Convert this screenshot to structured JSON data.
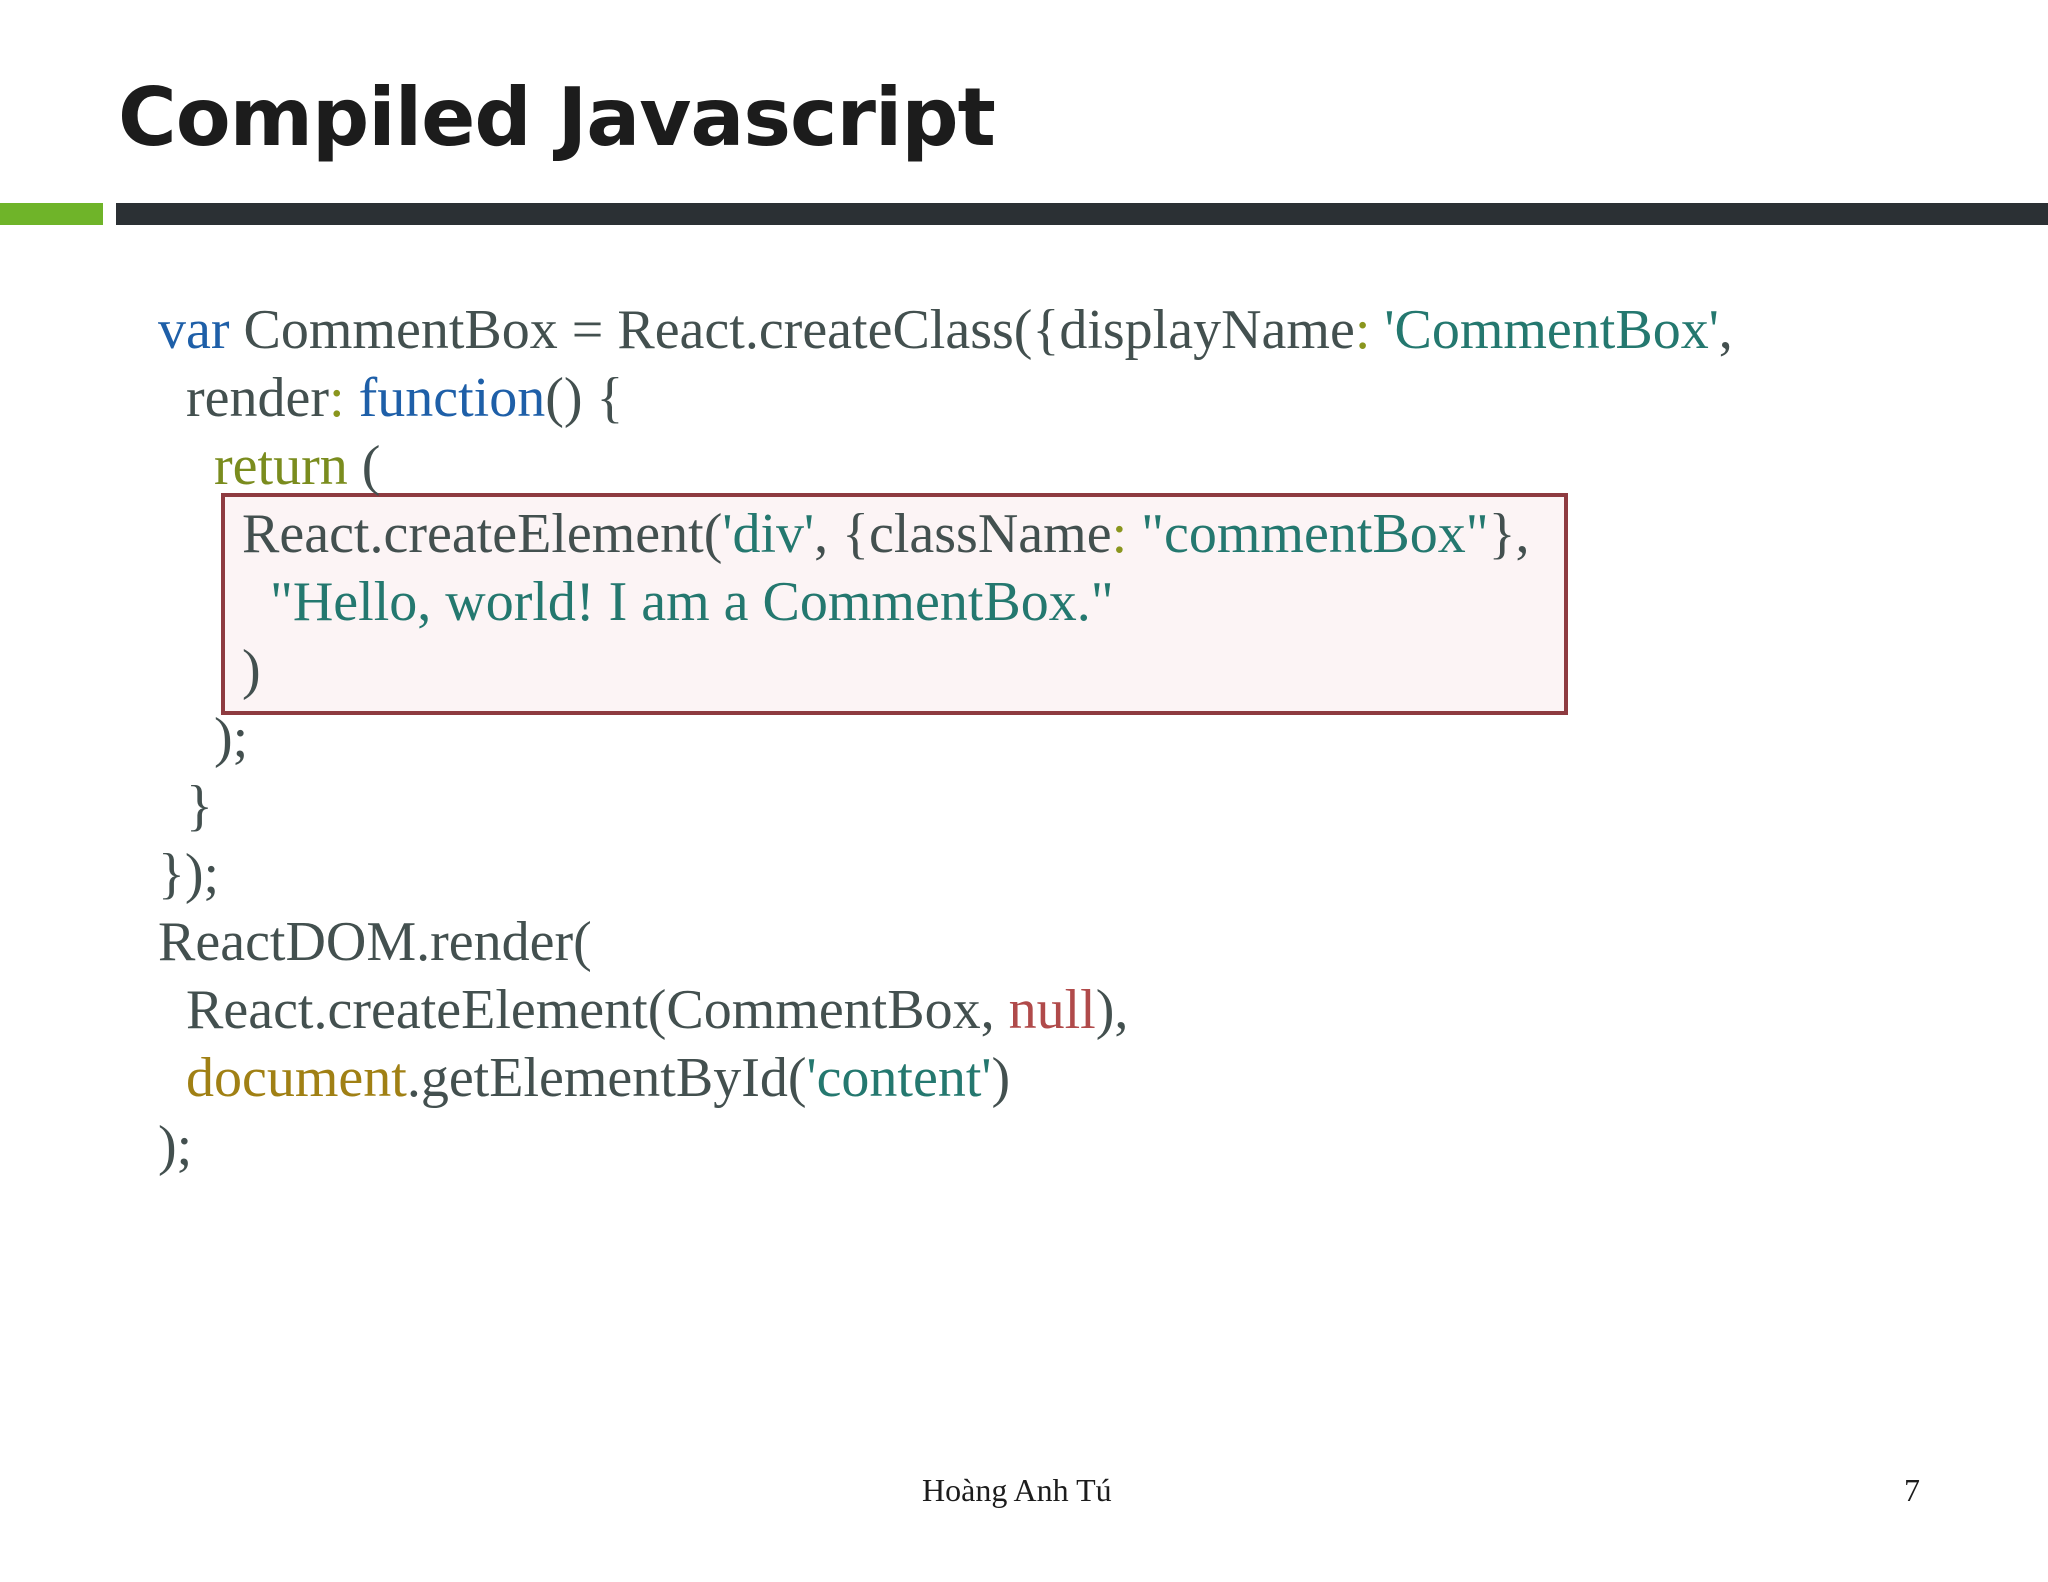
{
  "slide": {
    "title": "Compiled Javascript",
    "footer_author": "Hoàng Anh Tú",
    "page_number": "7"
  },
  "code": {
    "l1_var": "var",
    "l1_a": " CommentBox ",
    "l1_eq": "=",
    "l1_b": " React.createClass({displayName",
    "l1_colon": ":",
    "l1_str": " 'CommentBox'",
    "l1_c": ",",
    "l2_a": "  render",
    "l2_colon": ":",
    "l2_fn": " function",
    "l2_b": "() {",
    "l3_ret": "    return",
    "l3_a": " (",
    "l4_a": "      React.createElement(",
    "l4_str1": "'div'",
    "l4_b": ", {className",
    "l4_colon": ":",
    "l4_str2": " \"commentBox\"",
    "l4_c": "},",
    "l5_str": "        \"Hello, world! I am a CommentBox.\"",
    "l6": "      )",
    "l7": "    );",
    "l8": "  }",
    "l9": "});",
    "l10": "ReactDOM.render(",
    "l11_a": "  React.createElement(CommentBox, ",
    "l11_null": "null",
    "l11_b": "),",
    "l12_doc": "  document",
    "l12_a": ".getElementById(",
    "l12_str": "'content'",
    "l12_b": ")",
    "l13": ");"
  },
  "colors": {
    "keyword": "#1e5fa8",
    "return_keyword": "#7a8c1e",
    "string": "#24786f",
    "null_literal": "#b04a4a",
    "document_object": "#a08014",
    "default_text": "#43504f",
    "highlight_border": "#8e3b40",
    "accent_green": "#6fb429",
    "rule_dark": "#2b3034"
  }
}
